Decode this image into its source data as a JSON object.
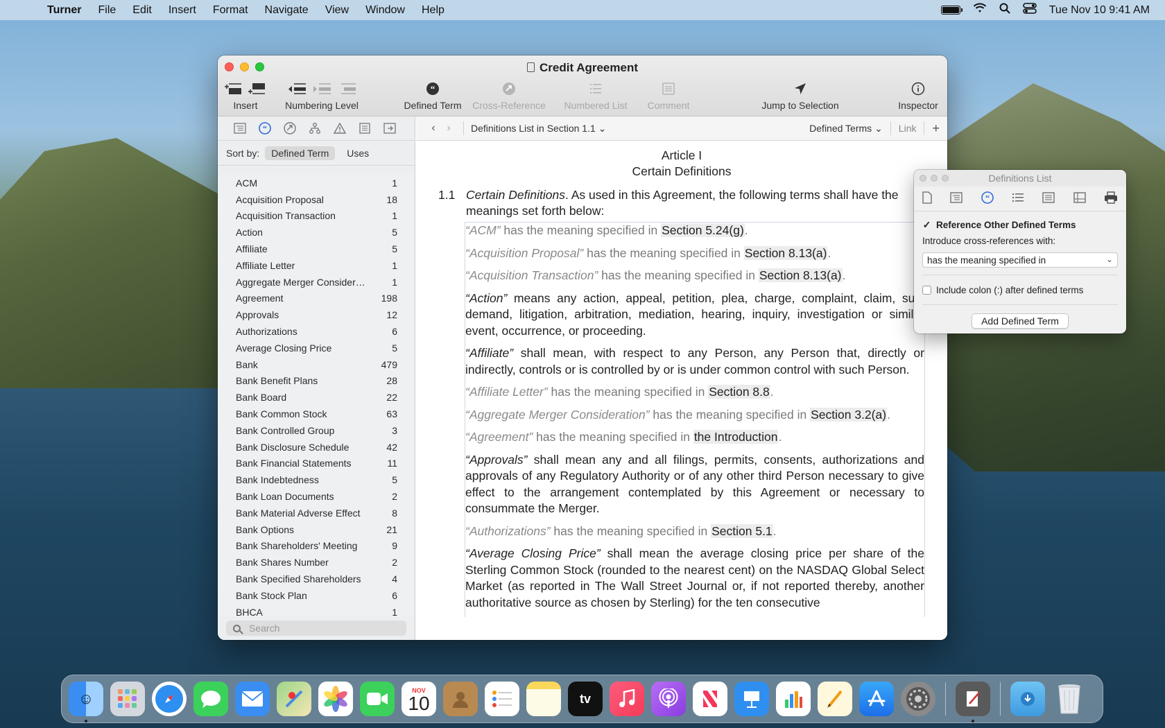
{
  "menubar": {
    "app_name": "Turner",
    "menus": [
      "File",
      "Edit",
      "Insert",
      "Format",
      "Navigate",
      "View",
      "Window",
      "Help"
    ],
    "clock": "Tue Nov 10  9:41 AM"
  },
  "window": {
    "title": "Credit Agreement",
    "toolbar": {
      "insert": "Insert",
      "numbering_level": "Numbering Level",
      "defined_term": "Defined Term",
      "cross_reference": "Cross-Reference",
      "numbered_list": "Numbered List",
      "comment": "Comment",
      "jump_to_selection": "Jump to Selection",
      "inspector": "Inspector"
    }
  },
  "sidebar": {
    "sort_label": "Sort by:",
    "sort_options": [
      "Defined Term",
      "Uses"
    ],
    "terms": [
      {
        "name": "ACM",
        "count": "1"
      },
      {
        "name": "Acquisition Proposal",
        "count": "18"
      },
      {
        "name": "Acquisition Transaction",
        "count": "1"
      },
      {
        "name": "Action",
        "count": "5"
      },
      {
        "name": "Affiliate",
        "count": "5"
      },
      {
        "name": "Affiliate Letter",
        "count": "1"
      },
      {
        "name": "Aggregate Merger Considerati...",
        "count": "1"
      },
      {
        "name": "Agreement",
        "count": "198"
      },
      {
        "name": "Approvals",
        "count": "12"
      },
      {
        "name": "Authorizations",
        "count": "6"
      },
      {
        "name": "Average Closing Price",
        "count": "5"
      },
      {
        "name": "Bank",
        "count": "479"
      },
      {
        "name": "Bank Benefit Plans",
        "count": "28"
      },
      {
        "name": "Bank Board",
        "count": "22"
      },
      {
        "name": "Bank Common Stock",
        "count": "63"
      },
      {
        "name": "Bank Controlled Group",
        "count": "3"
      },
      {
        "name": "Bank Disclosure Schedule",
        "count": "42"
      },
      {
        "name": "Bank Financial Statements",
        "count": "11"
      },
      {
        "name": "Bank Indebtedness",
        "count": "5"
      },
      {
        "name": "Bank Loan Documents",
        "count": "2"
      },
      {
        "name": "Bank Material Adverse Effect",
        "count": "8"
      },
      {
        "name": "Bank Options",
        "count": "21"
      },
      {
        "name": "Bank Shareholders' Meeting",
        "count": "9"
      },
      {
        "name": "Bank Shares Number",
        "count": "2"
      },
      {
        "name": "Bank Specified Shareholders",
        "count": "4"
      },
      {
        "name": "Bank Stock Plan",
        "count": "6"
      },
      {
        "name": "BHCA",
        "count": "1"
      }
    ],
    "search_placeholder": "Search"
  },
  "navbar": {
    "breadcrumb": "Definitions List in Section 1.1",
    "defined_terms": "Defined Terms",
    "link": "Link"
  },
  "document": {
    "article": "Article I",
    "article_title": "Certain Definitions",
    "section_number": "1.1",
    "section_heading": "Certain Definitions",
    "section_text": ". As used in this Agreement, the following terms shall have the meanings set forth below:",
    "definitions": [
      {
        "term": "“ACM”",
        "mid": " has the meaning specified in ",
        "ref": "Section 5.24(g)",
        "end": "."
      },
      {
        "term": "“Acquisition Proposal”",
        "mid": " has the meaning specified in ",
        "ref": "Section 8.13(a)",
        "end": "."
      },
      {
        "term": "“Acquisition Transaction”",
        "mid": " has the meaning specified in ",
        "ref": "Section 8.13(a)",
        "end": "."
      },
      {
        "term": "“Action”",
        "body": " means any action, appeal, petition, plea, charge, complaint, claim, suit, demand, litigation, arbitration, mediation, hearing, inquiry, investigation or similar event, occurrence, or proceeding."
      },
      {
        "term": "“Affiliate”",
        "body": " shall mean, with respect to any Person, any Person that, directly or indirectly, controls or is controlled by or is under common control with such Person."
      },
      {
        "term": "“Affiliate Letter”",
        "mid": " has the meaning specified in ",
        "ref": "Section 8.8",
        "end": "."
      },
      {
        "term": "“Aggregate Merger Consideration”",
        "mid": " has the meaning specified in ",
        "ref": "Section 3.2(a)",
        "end": "."
      },
      {
        "term": "“Agreement”",
        "mid": " has the meaning specified in ",
        "ref": "the Introduction",
        "end": "."
      },
      {
        "term": "“Approvals”",
        "body": " shall mean any and all filings, permits, consents, authorizations and approvals of any Regulatory Authority or of any other third Person necessary to give effect to the arrangement contemplated by this Agreement or necessary to consummate the Merger."
      },
      {
        "term": "“Authorizations”",
        "mid": " has the meaning specified in ",
        "ref": "Section 5.1",
        "end": "."
      },
      {
        "term": "“Average Closing Price”",
        "body": " shall mean the average closing price per share of the Sterling Common Stock (rounded to the nearest cent) on the NASDAQ Global Select Market (as reported in The Wall Street Journal or, if not reported thereby, another authoritative source as chosen by Sterling) for the ten consecutive"
      }
    ]
  },
  "panel": {
    "title": "Definitions List",
    "reference_other": "Reference Other Defined Terms",
    "introduce_label": "Introduce cross-references with:",
    "introduce_value": "has the meaning specified in",
    "include_colon": "Include colon (:) after defined terms",
    "add_button": "Add Defined Term"
  },
  "dock": {
    "calendar_month": "NOV",
    "calendar_day": "10",
    "tv_label": "tv"
  }
}
